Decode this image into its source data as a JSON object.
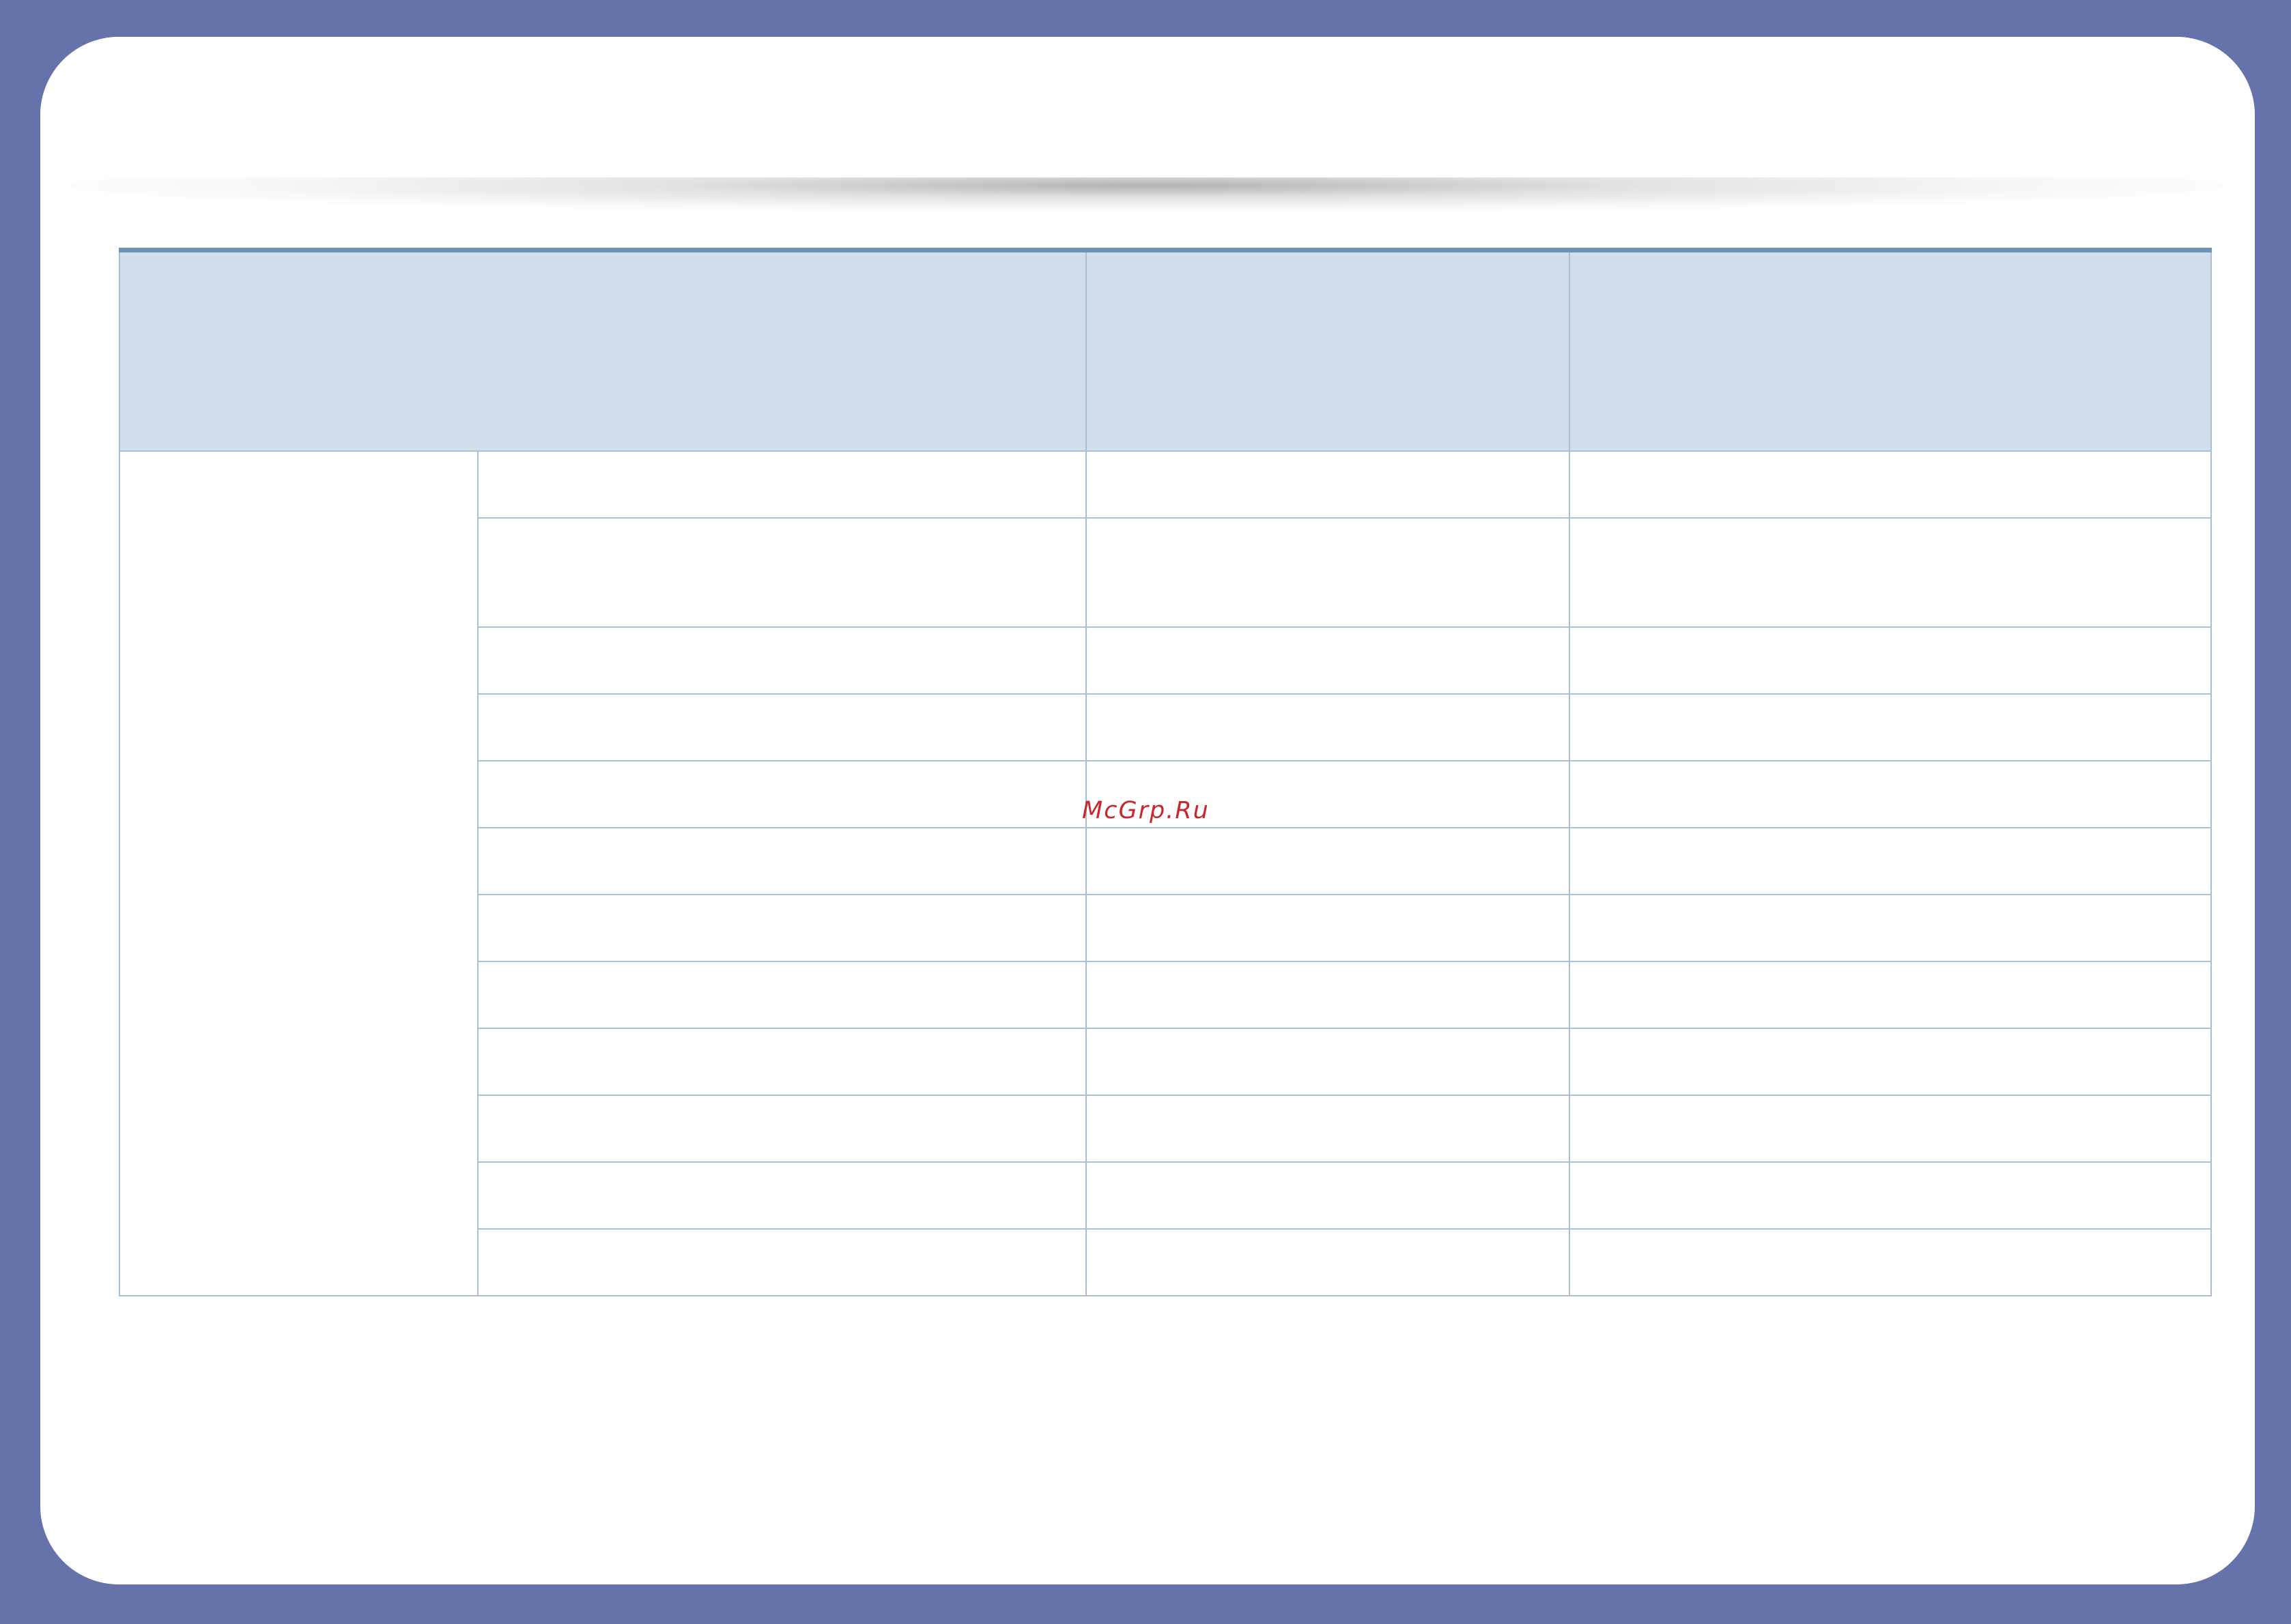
{
  "watermark": {
    "text": "McGrp.Ru"
  },
  "colors": {
    "frame": "#6673aa",
    "table_header_bg": "#d2dee9",
    "table_border": "#a8bfd8",
    "table_top_rule": "#6b93b7",
    "watermark": "#c8272f"
  },
  "table": {
    "header": [
      "",
      "",
      ""
    ],
    "group_label": "",
    "rows": [
      [
        "",
        "",
        ""
      ],
      [
        "",
        "",
        ""
      ],
      [
        "",
        "",
        ""
      ],
      [
        "",
        "",
        ""
      ],
      [
        "",
        "",
        ""
      ],
      [
        "",
        "",
        ""
      ],
      [
        "",
        "",
        ""
      ],
      [
        "",
        "",
        ""
      ],
      [
        "",
        "",
        ""
      ],
      [
        "",
        "",
        ""
      ],
      [
        "",
        "",
        ""
      ],
      [
        "",
        "",
        ""
      ]
    ]
  }
}
